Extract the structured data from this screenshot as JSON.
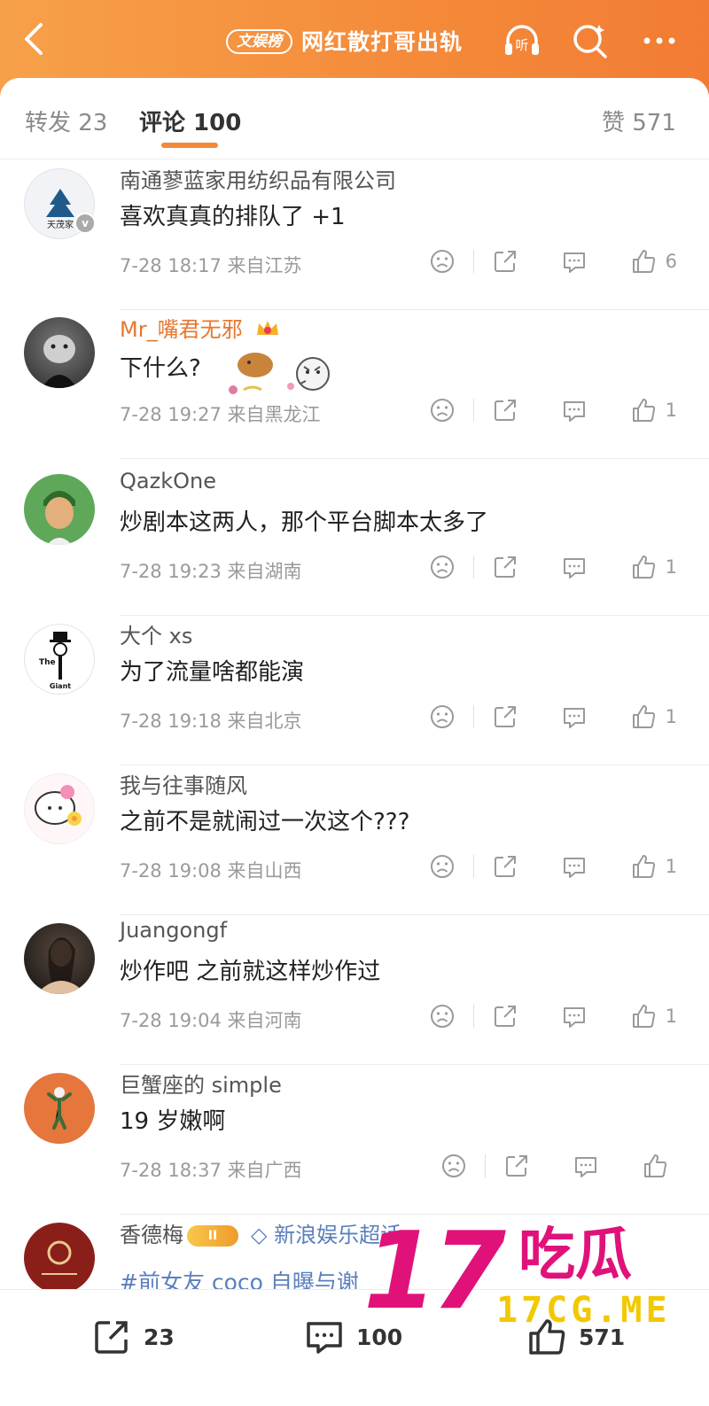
{
  "header": {
    "badge": "文娱榜",
    "title": "网红散打哥出轨",
    "listen_label": "听"
  },
  "tabs": {
    "repost": "转发 23",
    "comments": "评论 100",
    "likes": "赞 571"
  },
  "comments": [
    {
      "user": "南通蓼蓝家用纺织品有限公司",
      "text": "喜欢真真的排队了 +1",
      "time": "7-28 18:17",
      "location": "来自江苏",
      "likes": "6",
      "avatar_text": "天茂家"
    },
    {
      "user": "Mr_嘴君无邪",
      "text": "下什么?",
      "time": "7-28 19:27",
      "location": "来自黑龙江",
      "likes": "1"
    },
    {
      "user": "QazkOne",
      "text": "炒剧本这两人，那个平台脚本太多了",
      "time": "7-28 19:23",
      "location": "来自湖南",
      "likes": "1"
    },
    {
      "user": "大个 xs",
      "text": "为了流量啥都能演",
      "time": "7-28 19:18",
      "location": "来自北京",
      "likes": "1",
      "avatar_text_top": "The",
      "avatar_text_bottom": "Giant"
    },
    {
      "user": "我与往事随风",
      "text": "之前不是就闹过一次这个???",
      "time": "7-28 19:08",
      "location": "来自山西",
      "likes": "1"
    },
    {
      "user": "Juangongf",
      "text": "炒作吧 之前就这样炒作过",
      "time": "7-28 19:04",
      "location": "来自河南",
      "likes": "1"
    },
    {
      "user": "巨蟹座的 simple",
      "text": "19 岁嫩啊",
      "time": "7-28 18:37",
      "location": "来自广西",
      "likes": ""
    }
  ],
  "last_comment": {
    "user": "香德梅",
    "level": "II",
    "super_topic": "新浪娱乐超话",
    "topic_text": "#前女友 coco 自曝与谢"
  },
  "bottom": {
    "repost_count": "23",
    "comment_count": "100",
    "like_count": "571"
  },
  "watermark": {
    "big": "17",
    "cn": "吃瓜",
    "url": "17CG.ME"
  },
  "colors": {
    "header": "#f48a3a",
    "accent": "#f48a3a",
    "link": "#5a7fbd",
    "watermark_pink": "#e0127a",
    "watermark_yellow": "#f2c800"
  }
}
